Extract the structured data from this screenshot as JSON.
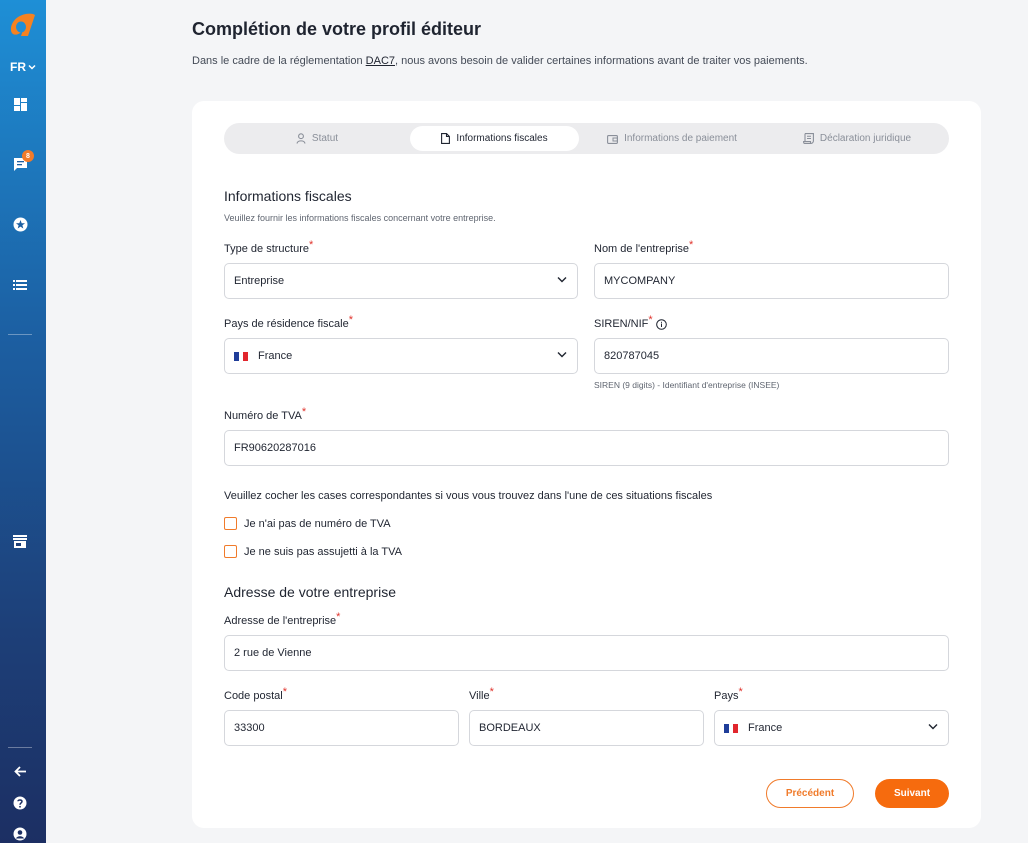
{
  "app": {
    "lang": "FR",
    "notification_count": "8"
  },
  "header": {
    "title": "Complétion de votre profil éditeur",
    "subtitle_before": "Dans le cadre de la réglementation ",
    "subtitle_link": "DAC7",
    "subtitle_after": ", nous avons besoin de valider certaines informations avant de traiter vos paiements."
  },
  "steps": [
    {
      "label": "Statut",
      "icon": "user-icon",
      "active": false
    },
    {
      "label": "Informations fiscales",
      "icon": "document-icon",
      "active": true
    },
    {
      "label": "Informations de paiement",
      "icon": "wallet-icon",
      "active": false
    },
    {
      "label": "Déclaration juridique",
      "icon": "scroll-icon",
      "active": false
    }
  ],
  "fiscal": {
    "title": "Informations fiscales",
    "description": "Veuillez fournir les informations fiscales concernant votre entreprise.",
    "structure_label": "Type de structure",
    "structure_value": "Entreprise",
    "company_label": "Nom de l'entreprise",
    "company_value": "MYCOMPANY",
    "country_label": "Pays de résidence fiscale",
    "country_value": "France",
    "siren_label": "SIREN/NIF",
    "siren_value": "820787045",
    "siren_hint": "SIREN (9 digits) - Identifiant d'entreprise (INSEE)",
    "vat_label": "Numéro de TVA",
    "vat_value": "FR90620287016",
    "question": "Veuillez cocher les cases correspondantes si vous vous trouvez dans l'une de ces situations fiscales",
    "check_no_vat": "Je n'ai pas de numéro de TVA",
    "check_not_subject": "Je ne suis pas assujetti à la TVA"
  },
  "address": {
    "title": "Adresse de votre entreprise",
    "street_label": "Adresse de l'entreprise",
    "street_value": "2 rue de Vienne",
    "zip_label": "Code postal",
    "zip_value": "33300",
    "city_label": "Ville",
    "city_value": "BORDEAUX",
    "country_label": "Pays",
    "country_value": "France"
  },
  "required_mark": "*",
  "buttons": {
    "prev": "Précédent",
    "next": "Suivant"
  },
  "colors": {
    "accent": "#f66b0e",
    "required": "#e0322b",
    "flag_blue": "#1f3d99",
    "flag_red": "#e1262d"
  }
}
